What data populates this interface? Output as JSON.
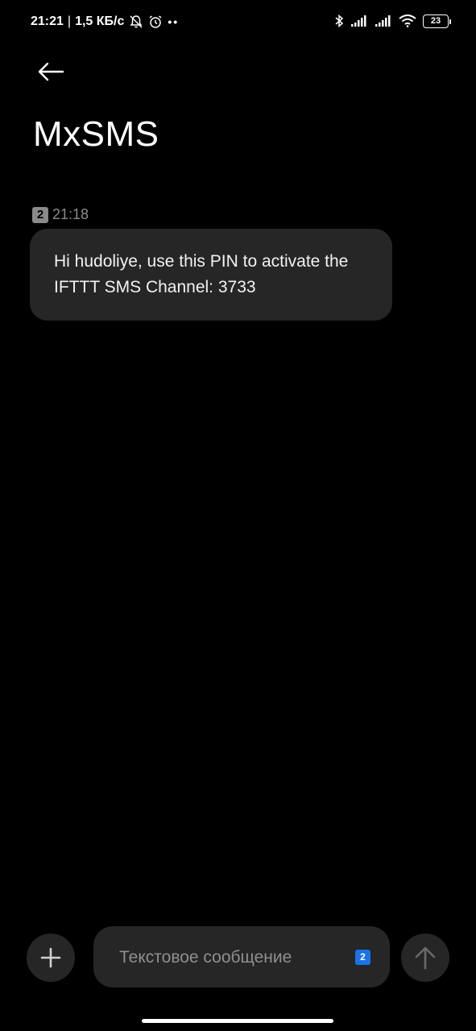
{
  "status_bar": {
    "time": "21:21",
    "separator": "|",
    "network_speed": "1,5 КБ/с",
    "icons": [
      "notifications-muted-icon",
      "alarm-icon",
      "more-dots-icon",
      "bluetooth-icon",
      "signal-icon",
      "signal-icon",
      "wifi-icon",
      "battery-icon"
    ],
    "battery_level": "23"
  },
  "header": {
    "back_icon": "arrow-left-icon",
    "title": "MxSMS"
  },
  "messages": [
    {
      "sim": "2",
      "time": "21:18",
      "text": "Hi hudoliye, use this PIN to activate the IFTTT SMS Channel: 3733"
    }
  ],
  "composer": {
    "add_icon": "plus-icon",
    "placeholder": "Текстовое сообщение",
    "sim": "2",
    "send_icon": "arrow-up-icon"
  },
  "colors": {
    "background": "#000000",
    "bubble": "#262626",
    "sim_badge_active": "#1a73e8"
  }
}
